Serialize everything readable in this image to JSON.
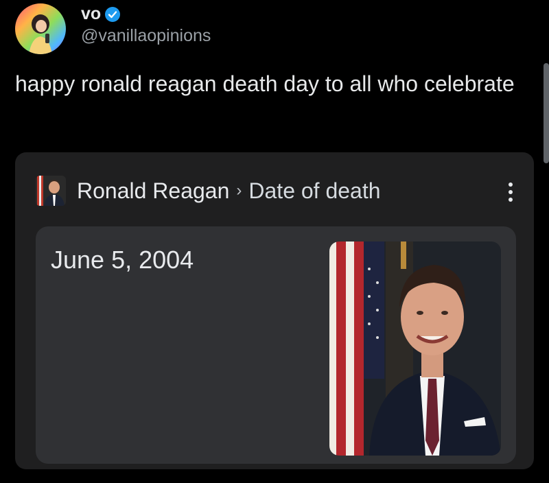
{
  "tweet": {
    "display_name": "vo",
    "handle": "@vanillaopinions",
    "text": "happy ronald reagan death day to all who celebrate"
  },
  "card": {
    "breadcrumb_entity": "Ronald Reagan",
    "breadcrumb_separator": "›",
    "breadcrumb_attribute": "Date of death",
    "answer": "June 5, 2004"
  },
  "icons": {
    "verified": "verified-badge-icon",
    "more": "more-vert-icon"
  },
  "colors": {
    "background": "#000000",
    "card": "#1f1f20",
    "panel": "#303134",
    "verified": "#1d9bf0"
  }
}
